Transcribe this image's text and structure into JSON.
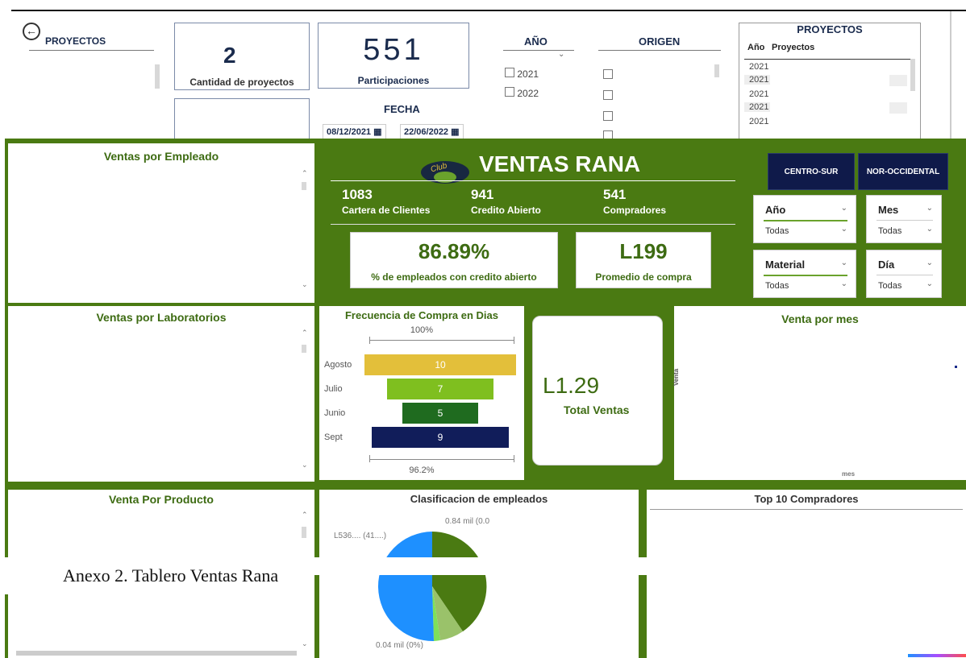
{
  "top_dashboard": {
    "back_icon": "arrow-left-circle-icon",
    "projects_label": "PROYECTOS",
    "kpi_projects_value": "2",
    "kpi_projects_label": "Cantidad de proyectos",
    "kpi_participations_value": "551",
    "kpi_participations_label": "Participaciones",
    "year_filter": {
      "title": "AÑO",
      "options": [
        "2021",
        "2022"
      ]
    },
    "origin_filter": {
      "title": "ORIGEN"
    },
    "date_filter": {
      "title": "FECHA",
      "start": "08/12/2021",
      "end": "22/06/2022"
    },
    "projects_table": {
      "title": "PROYECTOS",
      "columns": [
        "Año",
        "Proyectos"
      ],
      "rows": [
        "2021",
        "2021",
        "2021",
        "2021",
        "2021"
      ]
    }
  },
  "ventas": {
    "brand_logo": "rana-club-logo",
    "title": "VENTAS RANA",
    "stats": [
      {
        "value": "1083",
        "label": "Cartera de Clientes"
      },
      {
        "value": "941",
        "label": "Credito Abierto"
      },
      {
        "value": "541",
        "label": "Compradores"
      }
    ],
    "kpi_credit": {
      "value": "86.89%",
      "label": "% de empleados con credito abierto"
    },
    "kpi_average": {
      "value": "L199",
      "label": "Promedio de compra"
    },
    "region_buttons": [
      "CENTRO-SUR",
      "NOR-OCCIDENTAL"
    ],
    "filters": [
      {
        "label": "Año",
        "value": "Todas"
      },
      {
        "label": "Mes",
        "value": "Todas"
      },
      {
        "label": "Material",
        "value": "Todas"
      },
      {
        "label": "Día",
        "value": "Todas"
      }
    ],
    "panels": {
      "employee": "Ventas por Empleado",
      "labs": "Ventas por Laboratorios",
      "product": "Venta Por Producto",
      "month": "Venta por mes",
      "month_ylabel": "Venta",
      "month_xlabel": "mes",
      "classification": "Clasificacion de empleados",
      "top_buyers": "Top 10 Compradores"
    },
    "total_sales": {
      "value": "L1.29",
      "label": "Total Ventas"
    },
    "pie_labels": {
      "top": "0.84 mil (0.0",
      "left": "L536.... (41....)",
      "bottom": "0.04 mil (0%)"
    }
  },
  "chart_data": {
    "type": "bar",
    "title": "Frecuencia de Compra en Dias",
    "top_percent": "100%",
    "bottom_percent": "96.2%",
    "categories": [
      "Agosto",
      "Julio",
      "Junio",
      "Sept"
    ],
    "values": [
      10,
      7,
      5,
      9
    ],
    "colors": [
      "#e3bf3a",
      "#7fbf1f",
      "#1f6b1f",
      "#111d5a"
    ]
  },
  "caption": "Anexo 2. Tablero Ventas Rana",
  "colors": {
    "dashboard_green": "#4a7a12",
    "navy": "#0f1a4a",
    "accent_green": "#6aa22c"
  }
}
